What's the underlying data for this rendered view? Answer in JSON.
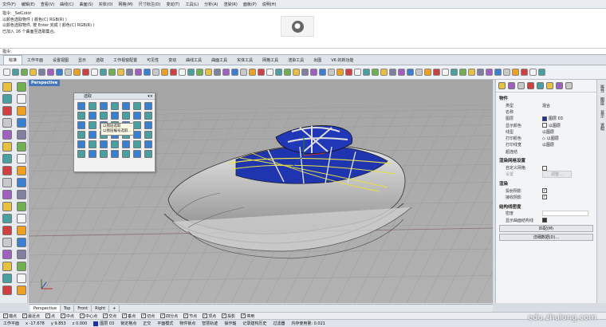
{
  "menu": [
    "文件(F)",
    "编辑(E)",
    "查看(V)",
    "曲线(C)",
    "曲面(S)",
    "实体(O)",
    "网格(M)",
    "尺寸标注(D)",
    "变动(T)",
    "工具(L)",
    "分析(A)",
    "渲染(R)",
    "面板(P)",
    "说明(H)"
  ],
  "command_history": [
    "指令: _SelColor",
    "以颜色选取物件 ( 颜色(C)  RGB(R) )",
    "以颜色选取物件, 按 Enter 完成 ( 颜色(C)  RGB(R) )",
    "已加入 16 个曲面至选取集合。"
  ],
  "command_prompt": "指令:",
  "tabs": [
    "标准",
    "工作平面",
    "设置视图",
    "显示",
    "选取",
    "工作视窗配置",
    "可见性",
    "变动",
    "曲线工具",
    "曲面工具",
    "实体工具",
    "网格工具",
    "渲染工具",
    "出图",
    "V6 的新功能"
  ],
  "active_tab": "标准",
  "viewport": {
    "title": "Perspective"
  },
  "viewport_tabs": [
    "Perspective",
    "Top",
    "Front",
    "Right",
    "+"
  ],
  "popup": {
    "title": "选取"
  },
  "tooltip": [
    "以图层选取",
    "以图层编号选取..."
  ],
  "panel": {
    "section_object": "物件",
    "rows": [
      {
        "key": "类型",
        "value": "混合"
      },
      {
        "key": "名称",
        "value": ""
      },
      {
        "key": "图层",
        "value": "图层 03",
        "swatch": "#1a2fa8"
      },
      {
        "key": "显示颜色",
        "value": "以图层",
        "swatch": "#ffffff"
      },
      {
        "key": "线型",
        "value": "以图层"
      },
      {
        "key": "打印颜色",
        "value": "以图层",
        "diamond": true
      },
      {
        "key": "打印线宽",
        "value": "以图层"
      },
      {
        "key": "超连结",
        "value": ""
      }
    ],
    "section_render_mesh": "渲染网格设置",
    "custom_mesh_label": "自定义网格",
    "settings_label": "设置",
    "adjust_label": "调整...",
    "section_render": "渲染",
    "cast_shadows": "投射阴影",
    "receive_shadows": "接收阴影",
    "section_isocurve": "结构线密度",
    "density_label": "密度",
    "show_isocurves": "显示曲面结构线",
    "match_button": "匹配(M)",
    "details_button": "详细数据(D)..."
  },
  "side_tabs": [
    "属性",
    "图层",
    "显示",
    "说明"
  ],
  "status_osnap": [
    "端点",
    "最近点",
    "点",
    "中点",
    "中心点",
    "交点",
    "垂点",
    "切点",
    "四分点",
    "节点",
    "顶点",
    "投影",
    "停用"
  ],
  "status_bar": {
    "workplane": "工作平面",
    "x": "x -17.678",
    "y": "y 9.853",
    "z": "z 0.000",
    "layer": "图层 03",
    "grid_snap": "锁定格点",
    "ortho": "正交",
    "planar": "平面模式",
    "osnap": "物件锁点",
    "smarttrack": "智慧轨迹",
    "gumball": "操作轴",
    "record_history": "记录建构历史",
    "filter": "过滤器",
    "cpu": "内存使用量: 0.021"
  },
  "watermark": "edu.zhulong.com"
}
